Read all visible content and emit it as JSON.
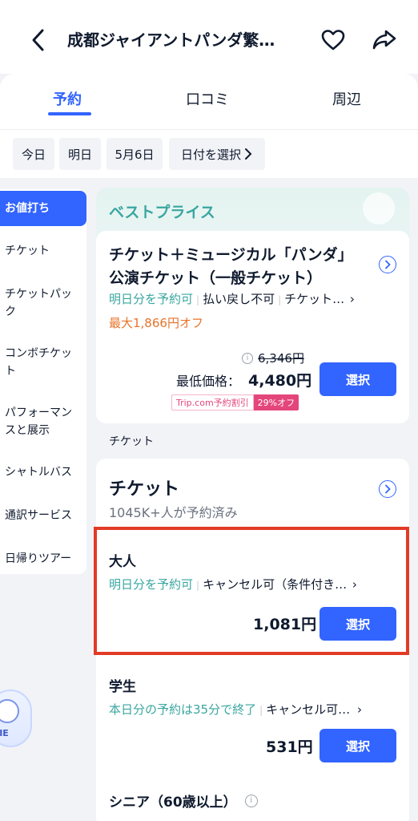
{
  "header": {
    "title": "成都ジャイアントパンダ繁…",
    "back_icon": "chevron-left-icon",
    "favorite_icon": "heart-icon",
    "share_icon": "share-icon"
  },
  "tabs": [
    {
      "label": "予約",
      "active": true
    },
    {
      "label": "口コミ",
      "active": false
    },
    {
      "label": "周辺",
      "active": false
    }
  ],
  "date_chips": [
    "今日",
    "明日",
    "5月6日",
    "日付を選択"
  ],
  "sidebar": {
    "items": [
      {
        "label": "お値打ち",
        "active": true
      },
      {
        "label": "チケット"
      },
      {
        "label": "チケットパック"
      },
      {
        "label": "コンボチケット"
      },
      {
        "label": "パフォーマンスと展示"
      },
      {
        "label": "シャトルバス"
      },
      {
        "label": "通訳サービス"
      },
      {
        "label": "日帰りツアー"
      }
    ]
  },
  "best_price": {
    "section_title": "ベストプライス",
    "product_title": "チケット＋ミュージカル「パンダ」公演チケット（一般チケット）",
    "tag_book": "明日分を予約可",
    "tag_refund": "払い戻し不可",
    "tag_more": "チケット…",
    "discount": "最大1,866円オフ",
    "original_price": "6,346円",
    "lowest_label": "最低価格：",
    "lowest_price": "4,480円",
    "promo_label": "Trip.com予約割引",
    "promo_discount": "29%オフ",
    "select_label": "選択"
  },
  "ticket_section_label": "チケット",
  "ticket_card": {
    "title": "チケット",
    "booked": "1045K+人が予約済み",
    "options": [
      {
        "name": "大人",
        "tag_book": "明日分を予約可",
        "tag_cancel": "キャンセル可（条件付き…",
        "price": "1,081円",
        "select_label": "選択",
        "highlighted": true
      },
      {
        "name": "学生",
        "tag_book": "本日分の予約は35分で終了",
        "tag_cancel": "キャンセル可…",
        "price": "531円",
        "select_label": "選択"
      }
    ],
    "next_option": "シニア（60歳以上）"
  },
  "assistant_badge": "NIE",
  "colors": {
    "accent": "#3264ff",
    "teal": "#3aa6a0",
    "orange": "#e8732a",
    "highlight": "#e23b25",
    "promo_pink": "#e4467c"
  }
}
